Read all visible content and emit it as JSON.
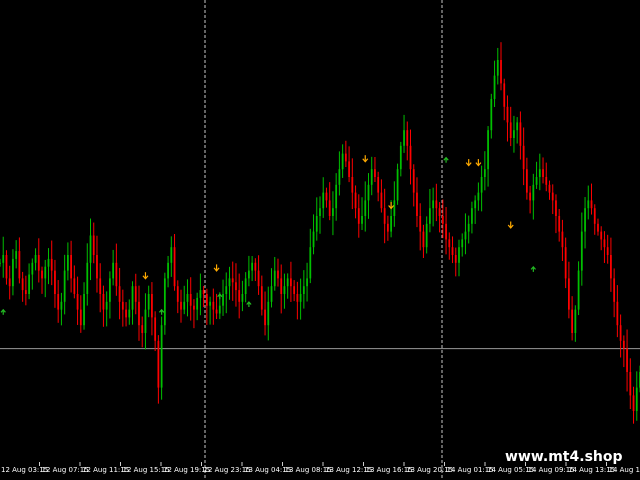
{
  "watermark": "www.mt4.shop",
  "colors": {
    "background": "#000000",
    "bull": "#00c000",
    "bear": "#ff0000",
    "grid_line": "#c8c8c8",
    "horizontal_line": "#9a9a9a",
    "arrow_up": "#22bb22",
    "arrow_down": "#ffaa00",
    "text": "#ffffff"
  },
  "chart_data": {
    "type": "candlestick",
    "title": "",
    "xlabel": "",
    "ylabel": "",
    "ylim": [
      0,
      100
    ],
    "grid": false,
    "day_separators": [
      "12 Aug 23:15",
      "14 Aug 00:15"
    ],
    "horizontal_level": 26,
    "x_tick_labels": [
      "12 Aug 03:15",
      "12 Aug 07:15",
      "12 Aug 11:15",
      "12 Aug 15:15",
      "12 Aug 19:15",
      "12 Aug 23:15",
      "13 Aug 04:15",
      "13 Aug 08:15",
      "13 Aug 12:15",
      "13 Aug 16:15",
      "13 Aug 20:15",
      "14 Aug 01:15",
      "14 Aug 05:15",
      "14 Aug 09:15",
      "14 Aug 13:15",
      "14 Aug 17:15"
    ],
    "close": [
      48,
      50,
      44,
      42,
      49,
      51,
      44,
      41,
      40,
      45,
      48,
      50,
      46,
      44,
      47,
      49,
      46,
      40,
      36,
      38,
      46,
      50,
      44,
      40,
      36,
      32,
      40,
      48,
      55,
      50,
      44,
      40,
      36,
      38,
      44,
      48,
      42,
      38,
      36,
      34,
      36,
      42,
      38,
      32,
      30,
      36,
      40,
      34,
      28,
      16,
      32,
      44,
      48,
      52,
      42,
      38,
      36,
      38,
      40,
      37,
      36,
      39,
      41,
      40,
      37,
      38,
      36,
      35,
      37,
      40,
      42,
      44,
      43,
      41,
      38,
      40,
      44,
      46,
      48,
      46,
      42,
      36,
      32,
      38,
      42,
      46,
      44,
      40,
      42,
      44,
      42,
      40,
      38,
      40,
      42,
      44,
      52,
      56,
      60,
      62,
      66,
      64,
      60,
      62,
      68,
      72,
      76,
      74,
      70,
      66,
      62,
      58,
      60,
      64,
      68,
      72,
      70,
      66,
      62,
      58,
      56,
      60,
      64,
      72,
      78,
      82,
      78,
      72,
      66,
      60,
      56,
      52,
      58,
      62,
      64,
      62,
      60,
      58,
      54,
      52,
      50,
      48,
      52,
      54,
      56,
      58,
      62,
      64,
      66,
      70,
      72,
      82,
      90,
      96,
      100,
      94,
      88,
      84,
      80,
      82,
      84,
      78,
      72,
      66,
      64,
      68,
      70,
      72,
      70,
      68,
      66,
      64,
      60,
      56,
      52,
      44,
      36,
      30,
      36,
      46,
      56,
      62,
      64,
      62,
      58,
      56,
      54,
      52,
      50,
      44,
      38,
      32,
      28,
      26,
      20,
      14,
      10,
      16,
      20
    ],
    "signals": [
      {
        "bar": 45,
        "dir": "down",
        "value": 42
      },
      {
        "bar": 67,
        "dir": "down",
        "value": 44
      },
      {
        "bar": 113,
        "dir": "down",
        "value": 72
      },
      {
        "bar": 121,
        "dir": "down",
        "value": 60
      },
      {
        "bar": 145,
        "dir": "down",
        "value": 71
      },
      {
        "bar": 148,
        "dir": "down",
        "value": 71
      },
      {
        "bar": 158,
        "dir": "down",
        "value": 55
      },
      {
        "bar": 1,
        "dir": "up",
        "value": 38
      },
      {
        "bar": 50,
        "dir": "up",
        "value": 38
      },
      {
        "bar": 68,
        "dir": "up",
        "value": 42
      },
      {
        "bar": 77,
        "dir": "up",
        "value": 40
      },
      {
        "bar": 138,
        "dir": "up",
        "value": 77
      },
      {
        "bar": 165,
        "dir": "up",
        "value": 49
      }
    ]
  }
}
